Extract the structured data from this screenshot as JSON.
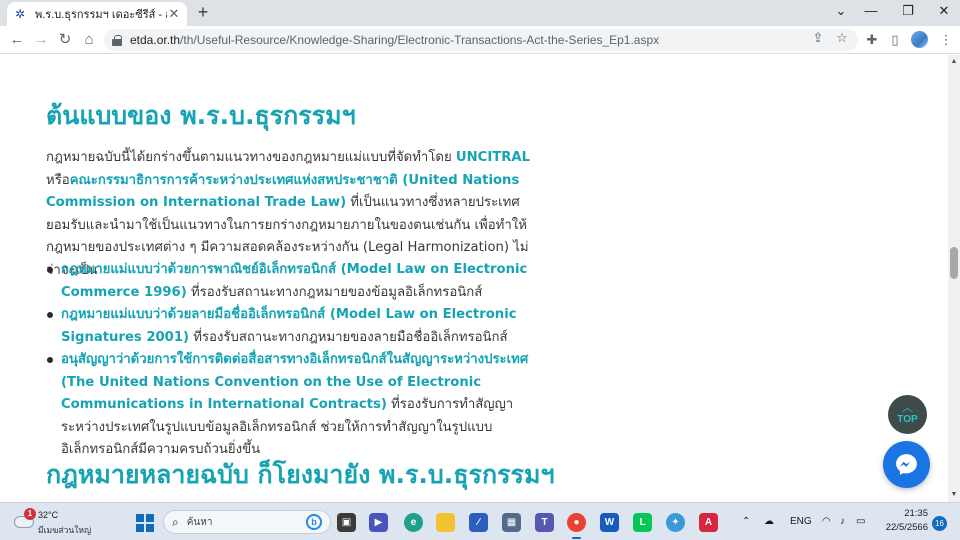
{
  "browser": {
    "tab_title": "พ.ร.บ.ธุรกรรมฯ เดอะซีรีส์ - สพธอ.",
    "tab_close": "✕",
    "new_tab": "+",
    "url_host": "etda.or.th",
    "url_path": "/th/Useful-Resource/Knowledge-Sharing/Electronic-Transactions-Act-the-Series_Ep1.aspx",
    "icons": [
      "back-icon",
      "forward-icon",
      "reload-icon",
      "home-icon",
      "lock-icon",
      "share-icon",
      "star-icon",
      "extensions-icon",
      "sidepanel-icon",
      "profile-icon",
      "menu-icon"
    ]
  },
  "content": {
    "heading1": "ต้นแบบของ พ.ร.บ.ธุรกรรมฯ",
    "para": {
      "t1": "กฎหมายฉบับนี้ได้ยกร่างขึ้นตามแนวทางของกฎหมายแม่แบบที่จัดทำโดย ",
      "uncitral": "UNCITRAL",
      "t2": " หรือ",
      "commission": "คณะกรรมาธิการการค้าระหว่างประเทศแห่งสหประชาชาติ (United Nations Commission on International Trade Law)",
      "t3": " ที่เป็นแนวทางซึ่งหลายประเทศยอมรับและนำมาใช้เป็นแนวทางในการยกร่างกฎหมายภายในของตนเช่นกัน เพื่อทำให้กฎหมายของประเทศต่าง ๆ มีความสอดคล้องระหว่างกัน (Legal Harmonization) ไม่ว่าจะเป็น"
    },
    "bullets": [
      {
        "hl": "กฎหมายแม่แบบว่าด้วยการพาณิชย์อิเล็กทรอนิกส์ (Model Law on Electronic Commerce 1996)",
        "text": " ที่รองรับสถานะทางกฎหมายของข้อมูลอิเล็กทรอนิกส์"
      },
      {
        "hl": "กฎหมายแม่แบบว่าด้วยลายมือชื่ออิเล็กทรอนิกส์ (Model Law on Electronic Signatures 2001)",
        "text": " ที่รองรับสถานะทางกฎหมายของลายมือชื่ออิเล็กทรอนิกส์"
      },
      {
        "hl": "อนุสัญญาว่าด้วยการใช้การติดต่อสื่อสารทางอิเล็กทรอนิกส์ในสัญญาระหว่างประเทศ (The United Nations Convention on the Use of Electronic Communications in International Contracts)",
        "text": " ที่รองรับการทำสัญญาระหว่างประเทศในรูปแบบข้อมูลอิเล็กทรอนิกส์ ช่วยให้การทำสัญญาในรูปแบบอิเล็กทรอนิกส์มีความครบถ้วนยิ่งขึ้น"
      }
    ],
    "heading2": "กฎหมายหลายฉบับ ก็โยงมายัง พ.ร.บ.ธุรกรรมฯ",
    "top_button": "TOP",
    "colors": {
      "accent": "#16a3b4",
      "messenger": "#1b74e4"
    }
  },
  "taskbar": {
    "weather_temp": "32°C",
    "weather_desc": "มีเมฆส่วนใหญ่",
    "weather_badge": "1",
    "search_placeholder": "ค้นหา",
    "apps": [
      "widgets",
      "task-view",
      "meet",
      "edge",
      "file-explorer",
      "visual-studio",
      "store",
      "teams",
      "chrome",
      "word",
      "line",
      "network-tool",
      "acrobat"
    ],
    "tray_lang": "ENG",
    "time": "21:35",
    "date": "22/5/2566",
    "notifications": "16"
  }
}
